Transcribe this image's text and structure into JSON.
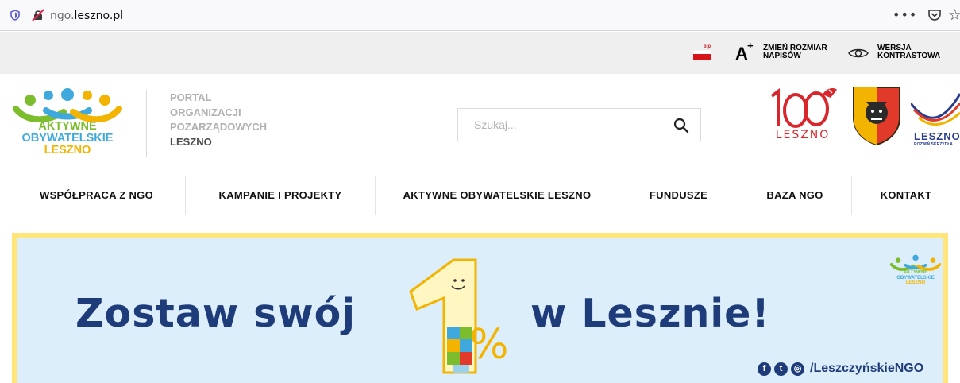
{
  "browser": {
    "url_domain": "ngo.",
    "url_rest": "leszno.pl",
    "menu_dots": "•••"
  },
  "topbar": {
    "bip_label": "bip",
    "font_size_letter": "A",
    "font_size_plus": "+",
    "font_size_label_line1": "ZMIEŃ ROZMIAR",
    "font_size_label_line2": "NAPISÓW",
    "contrast_label_line1": "WERSJA",
    "contrast_label_line2": "KONTRASTOWA"
  },
  "header": {
    "logo": {
      "line1": "AKTYWNE",
      "line2": "OBYWATELSKIE",
      "line3": "LESZNO"
    },
    "portal": {
      "line1": "PORTAL",
      "line2": "ORGANIZACJI",
      "line3": "POZARZĄDOWYCH",
      "line4": "LESZNO"
    },
    "search": {
      "placeholder": "Szukaj..."
    },
    "logo100_text": "LESZNO",
    "eu_text": "LESZNO",
    "eu_sub": "ROZWIŃ SKRZYDŁA"
  },
  "nav": {
    "items": [
      {
        "label": "WSPÓŁPRACA Z NGO"
      },
      {
        "label": "KAMPANIE I PROJEKTY"
      },
      {
        "label": "AKTYWNE OBYWATELSKIE LESZNO"
      },
      {
        "label": "FUNDUSZE"
      },
      {
        "label": "BAZA NGO"
      },
      {
        "label": "KONTAKT"
      }
    ]
  },
  "banner": {
    "text_left": "Zostaw swój",
    "text_right": "w Lesznie!",
    "percent_sign": "%",
    "social_handle": "/LeszczyńskieNGO",
    "mini_logo": {
      "line1": "AKTYWNE",
      "line2": "OBYWATELSKIE",
      "line3": "LESZNO"
    }
  },
  "colors": {
    "brand_green": "#7cbd2e",
    "brand_blue": "#3fa9dd",
    "brand_yellow": "#f2b400",
    "banner_navy": "#1f3c7a",
    "banner_bg": "#ddeefb",
    "banner_border": "#ffe57a"
  }
}
